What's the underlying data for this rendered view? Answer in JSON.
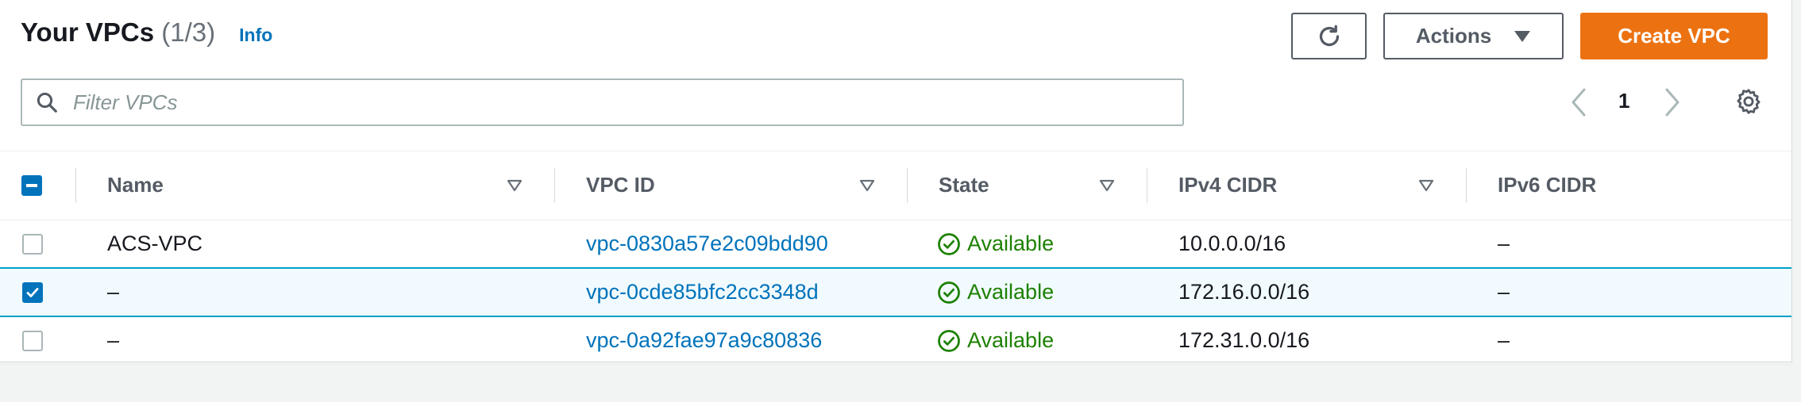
{
  "header": {
    "title": "Your VPCs",
    "count": "(1/3)",
    "info_link": "Info"
  },
  "toolbar": {
    "actions_label": "Actions",
    "create_label": "Create VPC"
  },
  "filter": {
    "placeholder": "Filter VPCs"
  },
  "pagination": {
    "current_page": "1"
  },
  "table": {
    "columns": {
      "name": "Name",
      "vpc_id": "VPC ID",
      "state": "State",
      "ipv4": "IPv4 CIDR",
      "ipv6": "IPv6 CIDR"
    },
    "rows": [
      {
        "selected": false,
        "name": "ACS-VPC",
        "vpc_id": "vpc-0830a57e2c09bdd90",
        "state": "Available",
        "ipv4": "10.0.0.0/16",
        "ipv6": "–"
      },
      {
        "selected": true,
        "name": "–",
        "vpc_id": "vpc-0cde85bfc2cc3348d",
        "state": "Available",
        "ipv4": "172.16.0.0/16",
        "ipv6": "–"
      },
      {
        "selected": false,
        "name": "–",
        "vpc_id": "vpc-0a92fae97a9c80836",
        "state": "Available",
        "ipv4": "172.31.0.0/16",
        "ipv6": "–"
      }
    ]
  },
  "colors": {
    "accent": "#ec7211",
    "link": "#0073bb",
    "success": "#1d8102",
    "selected_row_bg": "#f1faff",
    "selected_row_border": "#00a1c9"
  },
  "icons": {
    "refresh": "refresh-icon",
    "actions_caret": "caret-down-icon",
    "search": "search-icon",
    "prev": "chevron-left-icon",
    "next": "chevron-right-icon",
    "settings": "gear-icon",
    "sort": "sort-triangle-icon",
    "status": "check-circle-icon"
  }
}
